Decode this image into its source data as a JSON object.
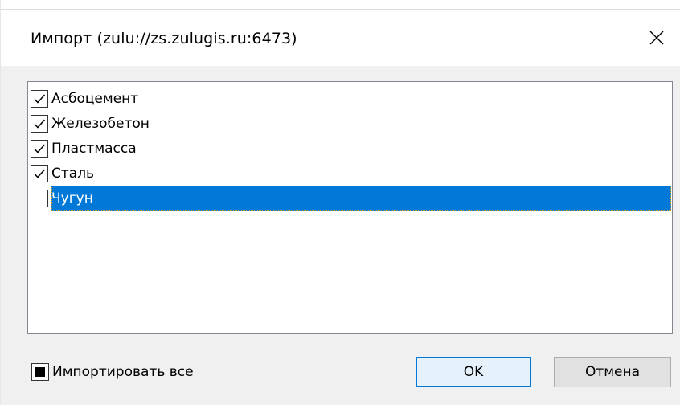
{
  "window": {
    "title": "Импорт (zulu://zs.zulugis.ru:6473)",
    "close_icon": "close-icon"
  },
  "list": {
    "items": [
      {
        "label": "Асбоцемент",
        "checked": true,
        "selected": false
      },
      {
        "label": "Железобетон",
        "checked": true,
        "selected": false
      },
      {
        "label": "Пластмасса",
        "checked": true,
        "selected": false
      },
      {
        "label": "Сталь",
        "checked": true,
        "selected": false
      },
      {
        "label": "Чугун",
        "checked": false,
        "selected": true
      }
    ]
  },
  "import_all": {
    "label": "Импортировать все",
    "state": "indeterminate"
  },
  "buttons": {
    "ok_label": "OK",
    "cancel_label": "Отмена"
  },
  "colors": {
    "selection": "#0078d7",
    "default_button_border": "#0078d7"
  }
}
